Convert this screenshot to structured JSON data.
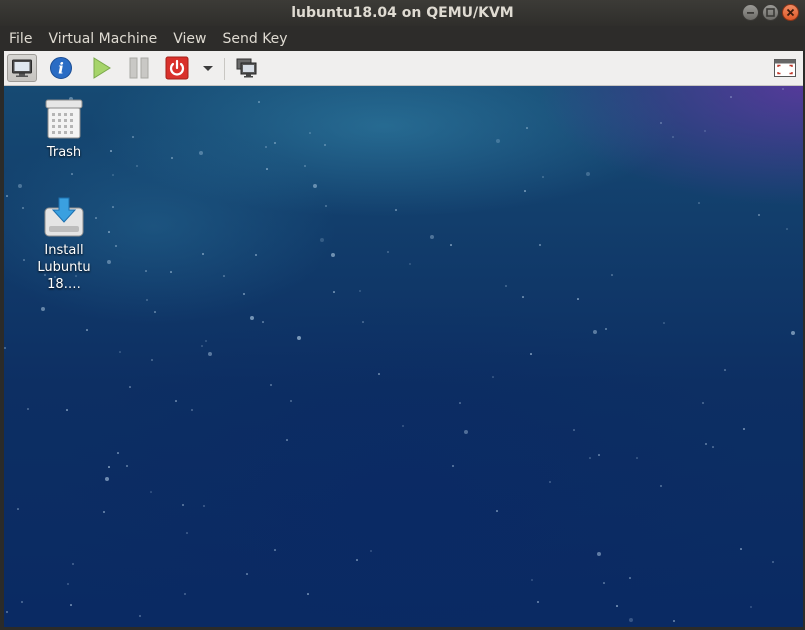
{
  "window": {
    "title": "lubuntu18.04 on QEMU/KVM",
    "controls": [
      "minimize-icon",
      "maximize-icon",
      "close-icon"
    ]
  },
  "menubar": {
    "items": [
      "File",
      "Virtual Machine",
      "View",
      "Send Key"
    ]
  },
  "toolbar": {
    "buttons": [
      {
        "name": "console-view-button",
        "icon": "monitor-icon",
        "active": true
      },
      {
        "name": "details-button",
        "icon": "info-icon"
      },
      {
        "name": "run-button",
        "icon": "play-icon"
      },
      {
        "name": "pause-button",
        "icon": "pause-icon"
      },
      {
        "name": "shutdown-button",
        "icon": "power-icon"
      },
      {
        "name": "shutdown-menu-button",
        "icon": "chevron-down-icon"
      },
      {
        "name": "snapshots-button",
        "icon": "snapshots-icon"
      },
      {
        "name": "fullscreen-button",
        "icon": "fullscreen-icon"
      }
    ]
  },
  "desktop": {
    "icons": [
      {
        "name": "trash",
        "label_line1": "Trash",
        "label_line2": ""
      },
      {
        "name": "install-lubuntu",
        "label_line1": "Install",
        "label_line2": "Lubuntu 18.…"
      }
    ]
  },
  "colors": {
    "titlebar": "#2f2e2b",
    "toolbar": "#f0efee",
    "power_red": "#d9312b",
    "play_green": "#a6d46a",
    "info_blue": "#2a6cc4",
    "desktop_base": "#0d2f63",
    "frame": "#7a1f3a"
  }
}
